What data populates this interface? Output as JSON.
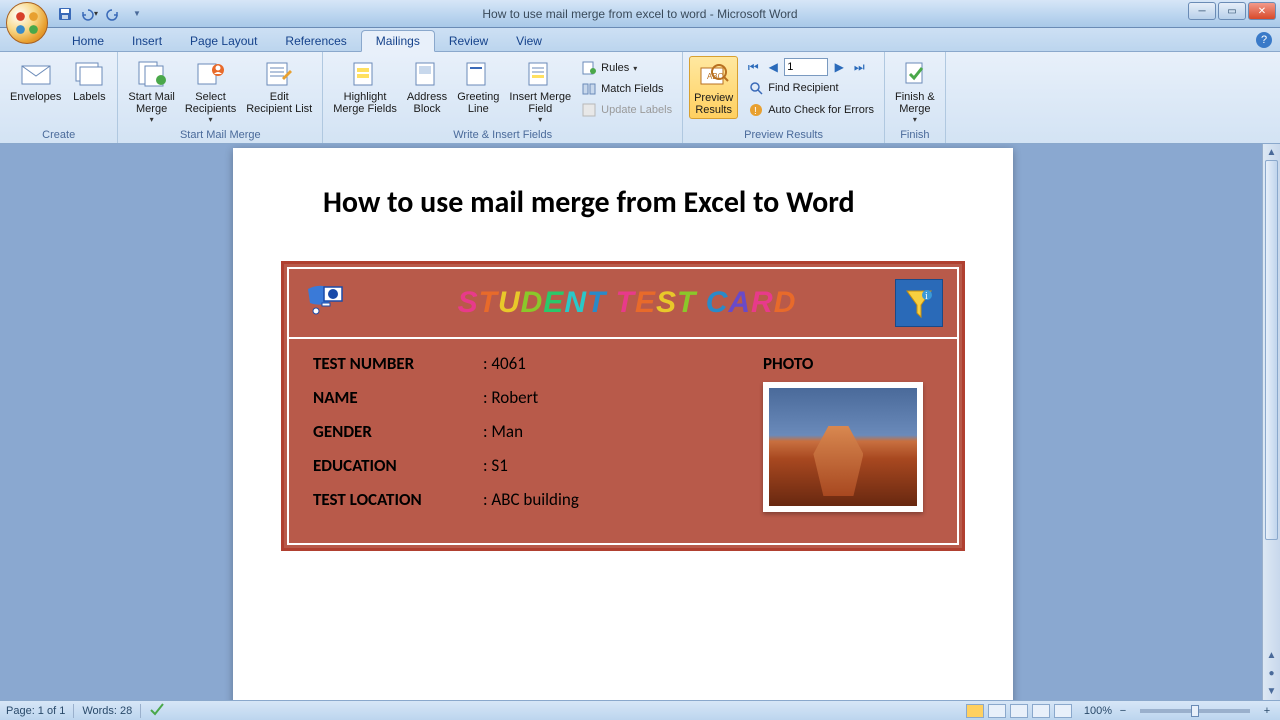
{
  "window": {
    "title": "How to use mail merge from excel to word - Microsoft Word"
  },
  "qat": {
    "save": "save",
    "undo": "undo",
    "redo": "redo"
  },
  "tabs": {
    "items": [
      "Home",
      "Insert",
      "Page Layout",
      "References",
      "Mailings",
      "Review",
      "View"
    ],
    "active_index": 4
  },
  "ribbon": {
    "groups": {
      "create": {
        "label": "Create",
        "envelopes": "Envelopes",
        "labels": "Labels"
      },
      "start": {
        "label": "Start Mail Merge",
        "start_mail_merge": "Start Mail\nMerge",
        "select_recipients": "Select\nRecipients",
        "edit_recipient_list": "Edit\nRecipient List"
      },
      "write": {
        "label": "Write & Insert Fields",
        "highlight": "Highlight\nMerge Fields",
        "address_block": "Address\nBlock",
        "greeting_line": "Greeting\nLine",
        "insert_merge_field": "Insert Merge\nField",
        "rules": "Rules",
        "match_fields": "Match Fields",
        "update_labels": "Update Labels"
      },
      "preview": {
        "label": "Preview Results",
        "preview_results": "Preview\nResults",
        "record_number": "1",
        "find_recipient": "Find Recipient",
        "auto_check": "Auto Check for Errors"
      },
      "finish": {
        "label": "Finish",
        "finish_merge": "Finish &\nMerge"
      }
    }
  },
  "document": {
    "heading": "How to use mail merge from Excel to Word",
    "card": {
      "title": "STUDENT TEST CARD",
      "photo_label": "PHOTO",
      "fields": [
        {
          "label": "TEST NUMBER",
          "value": ": 4061"
        },
        {
          "label": "NAME",
          "value": ": Robert"
        },
        {
          "label": "GENDER",
          "value": ": Man"
        },
        {
          "label": "EDUCATION",
          "value": ": S1"
        },
        {
          "label": "TEST LOCATION",
          "value": ": ABC building"
        }
      ]
    }
  },
  "statusbar": {
    "page": "Page: 1 of 1",
    "words": "Words: 28",
    "zoom": "100%",
    "zoom_minus": "−",
    "zoom_plus": "+"
  }
}
